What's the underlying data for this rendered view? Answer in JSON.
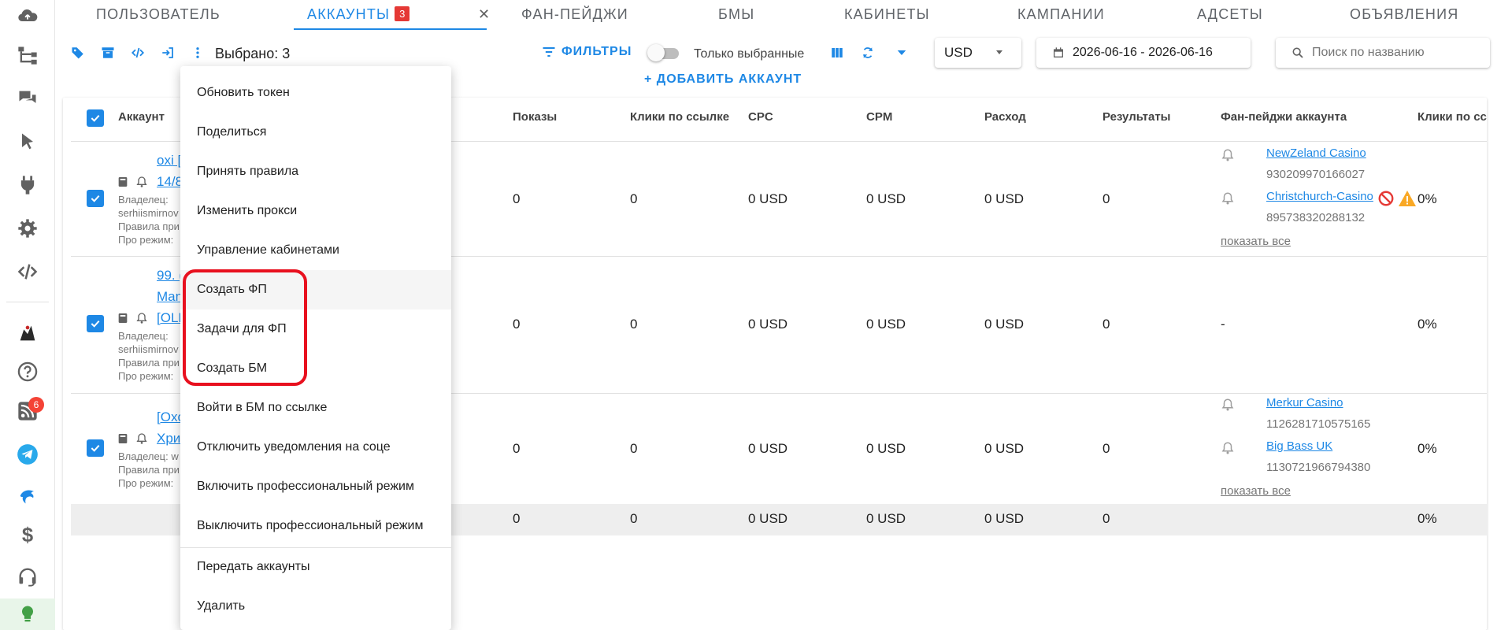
{
  "tabs": [
    {
      "label": "Пользователь"
    },
    {
      "label": "Аккаунты",
      "badge": "3"
    },
    {
      "label": "Фан-пейджи"
    },
    {
      "label": "БМы"
    },
    {
      "label": "Кабинеты"
    },
    {
      "label": "Кампании"
    },
    {
      "label": "Адсеты"
    },
    {
      "label": "Объявления"
    }
  ],
  "toolbar": {
    "selected": "Выбрано: 3",
    "filters": "ФИЛЬТРЫ",
    "only_selected": "Только выбранные",
    "add_account": "ДОБАВИТЬ АККАУНТ",
    "currency": "USD",
    "date_range": "2026-06-16 - 2026-06-16",
    "search_placeholder": "Поиск по названию"
  },
  "sidebar": {
    "rss_badge": "6",
    "icons": [
      "cloud-icon",
      "sitemap-icon",
      "chat-icon",
      "cursor-icon",
      "plug-icon",
      "gear-icon",
      "code-icon",
      "logo-icon",
      "help-icon",
      "rss-icon",
      "telegram-icon",
      "dolphin-icon",
      "dollar-icon",
      "headset-icon",
      "bulb-icon"
    ]
  },
  "table": {
    "headers": {
      "account": "Аккаунт",
      "impressions": "Показы",
      "link_clicks": "Клики по ссылке",
      "cpc": "CPC",
      "cpm": "CPM",
      "spend": "Расход",
      "results": "Результаты",
      "fanpages": "Фан-пейджи аккаунта",
      "link_clicks_2": "Клики по сс"
    },
    "rows": [
      {
        "name_line1": "oxi [",
        "name_line2": "14/8",
        "owner_label": "Владелец:",
        "owner": "serhiismirnov",
        "rules": "Правила при",
        "pro": "Про режим:",
        "impressions": "0",
        "link_clicks": "0",
        "cpc": "0 USD",
        "cpm": "0 USD",
        "spend": "0 USD",
        "results": "0",
        "fanpages": [
          {
            "name": "NewZeland Casino",
            "id": "930209970166027"
          },
          {
            "name": "Christchurch-Casino",
            "id": "895738320288132"
          }
        ],
        "show_all": "показать все",
        "ctr": "0%"
      },
      {
        "name_line1": "99. (",
        "name_line2": "Man",
        "name_line3": "[OLD",
        "owner_label": "Владелец:",
        "owner": "serhiismirnov",
        "rules": "Правила при",
        "pro": "Про режим:",
        "impressions": "0",
        "link_clicks": "0",
        "cpc": "0 USD",
        "cpm": "0 USD",
        "spend": "0 USD",
        "results": "0",
        "fanpages_empty": "-",
        "ctr": "0%"
      },
      {
        "name_line1": "[Oxo",
        "name_line2": "Хри",
        "owner_label": "Владелец: w",
        "rules": "Правила при",
        "pro": "Про режим:",
        "impressions": "0",
        "link_clicks": "0",
        "cpc": "0 USD",
        "cpm": "0 USD",
        "spend": "0 USD",
        "results": "0",
        "fanpages": [
          {
            "name": "Merkur Casino",
            "id": "1126281710575165"
          },
          {
            "name": "Big Bass UK",
            "id": "1130721966794380"
          }
        ],
        "show_all": "показать все",
        "ctr": "0%"
      }
    ],
    "totals": {
      "impressions": "0",
      "link_clicks": "0",
      "cpc": "0 USD",
      "cpm": "0 USD",
      "spend": "0 USD",
      "results": "0",
      "ctr": "0%"
    }
  },
  "menu": {
    "items": [
      "Обновить токен",
      "Поделиться",
      "Принять правила",
      "Изменить прокси",
      "Управление кабинетами",
      "Создать ФП",
      "Задачи для ФП",
      "Создать БМ",
      "Войти в БМ по ссылке",
      "Отключить уведомления на соце",
      "Включить профессиональный режим",
      "Выключить профессиональный режим",
      "Передать аккаунты",
      "Удалить"
    ],
    "hovered_index": 5
  },
  "colors": {
    "accent": "#1e88e5",
    "highlight": "#e8101e",
    "badge": "#e53935"
  }
}
